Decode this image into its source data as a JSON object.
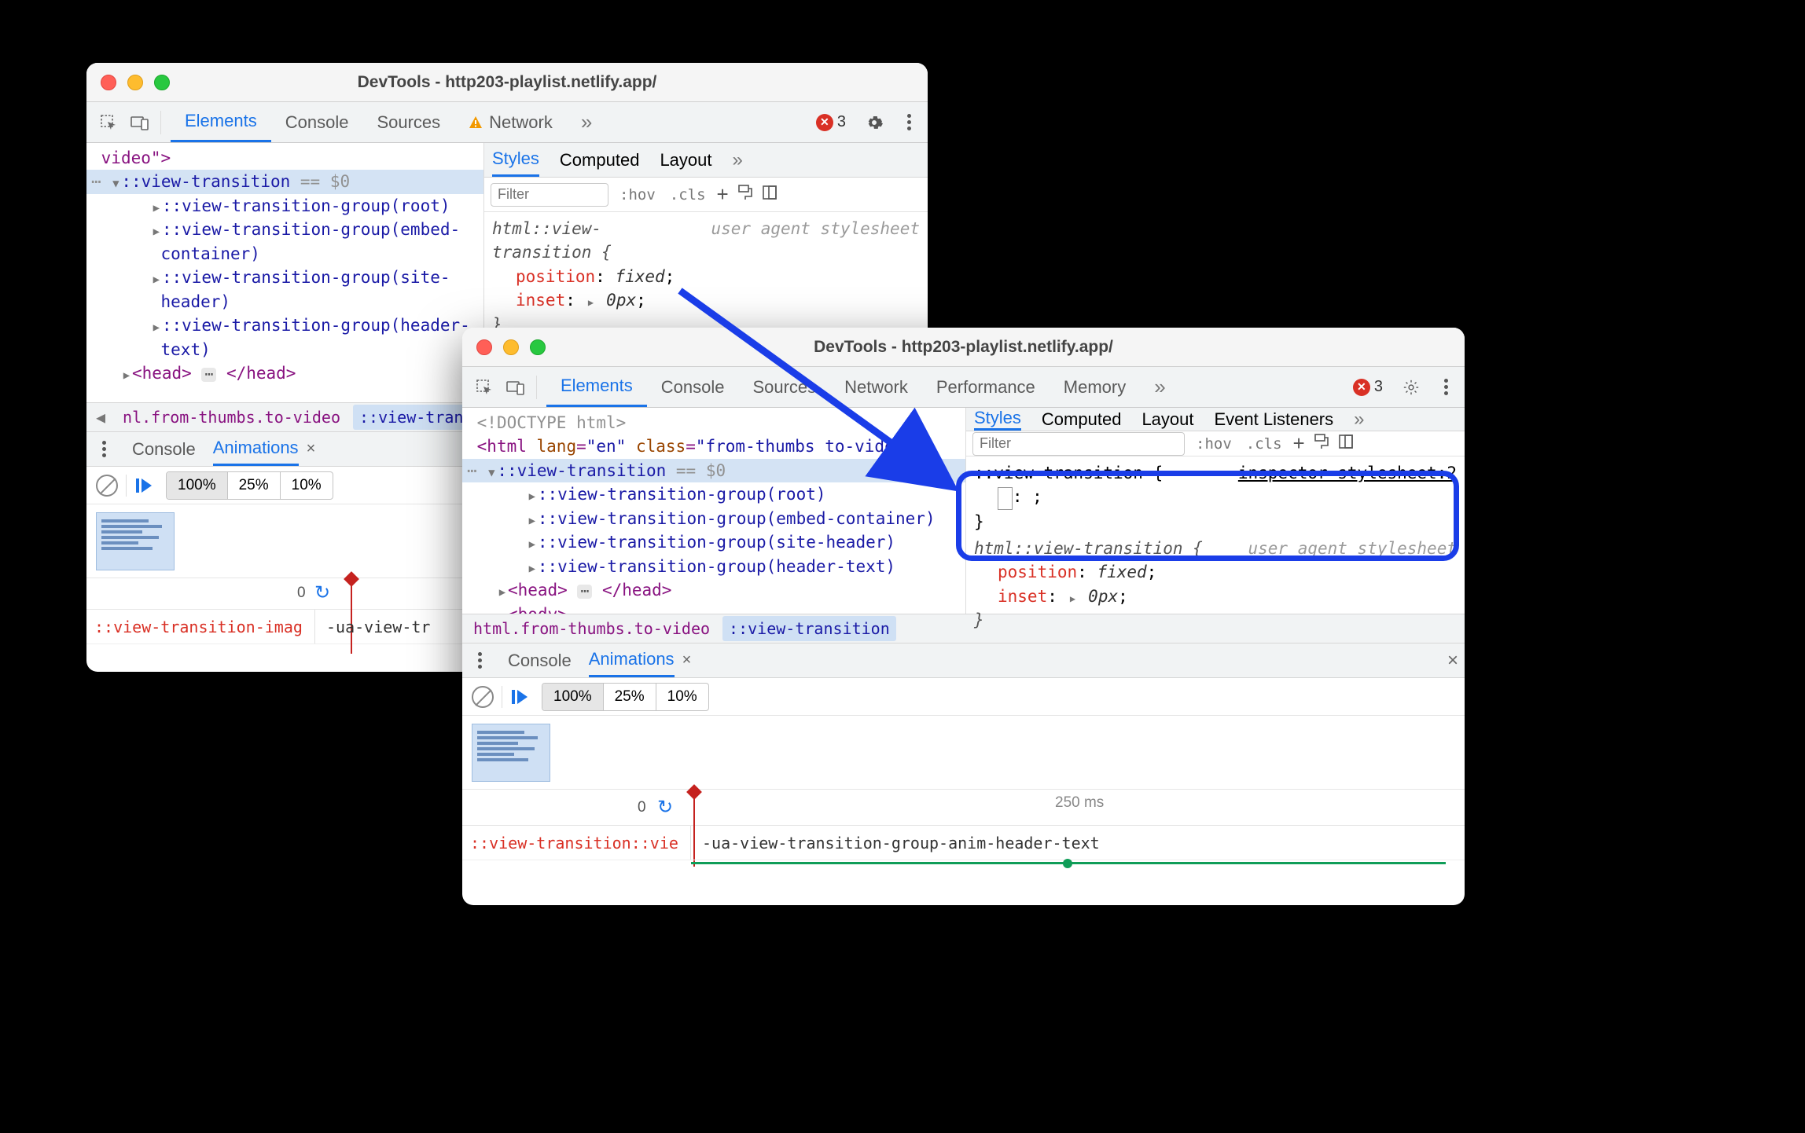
{
  "window_title": "DevTools - http203-playlist.netlify.app/",
  "tabs": {
    "elements": "Elements",
    "console": "Console",
    "sources": "Sources",
    "network": "Network",
    "performance": "Performance",
    "memory": "Memory"
  },
  "error_count": "3",
  "elements": {
    "line_video_end": "video\">",
    "doctype": "<!DOCTYPE html>",
    "html_open_a": "<html ",
    "html_lang_attr": "lang",
    "html_lang_val": "\"en\"",
    "html_class_attr": "class",
    "html_class_val": "\"from-thumbs to-video\"",
    "html_close": ">",
    "view_transition": "::view-transition",
    "eq_dollar0": " == $0",
    "group_root": "::view-transition-group(root)",
    "group_embed_a": "::view-transition-group(embed-",
    "group_embed_b": "container)",
    "group_embed_single": "::view-transition-group(embed-container)",
    "group_site_a": "::view-transition-group(site-",
    "group_site_b": "header)",
    "group_site_single": "::view-transition-group(site-header)",
    "group_header_a": "::view-transition-group(header-",
    "group_header_b": "text)",
    "group_header_single": "::view-transition-group(header-text)",
    "head_open": "<head>",
    "head_close": "</head>",
    "body_open": "<body>"
  },
  "breadcrumb": {
    "back_hint": "‹",
    "fwd_hint": "›",
    "item1_small": "nl.from-thumbs.to-video",
    "item1_big": "html.from-thumbs.to-video",
    "item2": "::view-transition"
  },
  "styles": {
    "tabs": {
      "styles": "Styles",
      "computed": "Computed",
      "layout": "Layout",
      "listeners": "Event Listeners"
    },
    "filter_placeholder": "Filter",
    "hov": ":hov",
    "cls": ".cls",
    "rule1_selector": "html::view-transition {",
    "rule1_source": "user agent stylesheet",
    "p_position": "position",
    "v_fixed": "fixed",
    "p_inset": "inset",
    "v_0px": "0px",
    "close_brace": "}",
    "rule2_selector": "::view-transition {",
    "rule2_source": "inspector-stylesheet:2",
    "empty_decl": ": ;"
  },
  "drawer": {
    "console": "Console",
    "animations": "Animations"
  },
  "anim": {
    "speed100": "100%",
    "speed25": "25%",
    "speed10": "10%",
    "zero": "0",
    "ms_250": "250 ms",
    "row_label_small": "::view-transition-imag",
    "row_name_small": "-ua-view-tr",
    "row_label_big": "::view-transition::vie",
    "row_name_big": "-ua-view-transition-group-anim-header-text"
  }
}
